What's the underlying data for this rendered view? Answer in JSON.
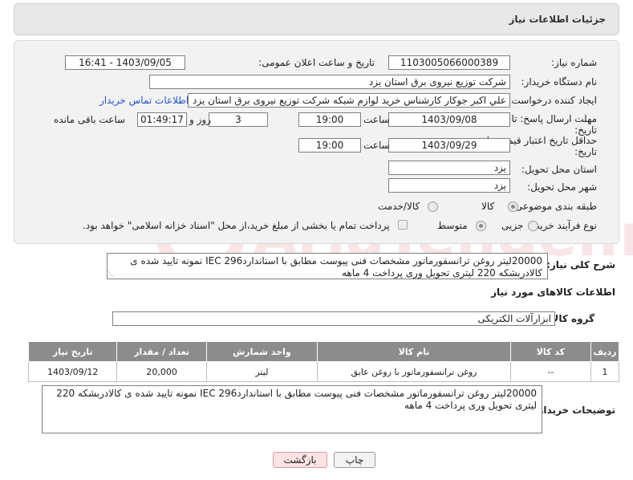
{
  "header": {
    "title": "جزئیات اطلاعات نیاز"
  },
  "form": {
    "need_number_label": "شماره نیاز:",
    "need_number": "1103005066000389",
    "announce_label": "تاریخ و ساعت اعلان عمومی:",
    "announce_value": "1403/09/05 - 16:41",
    "buyer_label": "نام دستگاه خریدار:",
    "buyer_value": "شرکت توزیع نیروی برق استان یزد",
    "requester_label": "ایجاد کننده درخواست:",
    "requester_value": "علي اکبر  جوکار  کارشناس خرید لوازم شبکه  شرکت توزیع نیروی برق استان یزد",
    "contact_link": "اطلاعات تماس خریدار",
    "deadline_label_1": "مهلت ارسال پاسخ: تا",
    "deadline_label_2": "تاریخ:",
    "deadline_date": "1403/09/08",
    "hour_label": "ساعت",
    "deadline_time": "19:00",
    "days_value": "3",
    "days_label": "روز و",
    "remaining_time": "01:49:17",
    "remaining_label": "ساعت باقی مانده",
    "validity_label_1": "حداقل تاریخ اعتبار قیمت: تا",
    "validity_label_2": "تاریخ:",
    "validity_date": "1403/09/29",
    "validity_time": "19:00",
    "province_label": "استان محل تحویل:",
    "province_value": "یزد",
    "city_label": "شهر محل تحویل:",
    "city_value": "یزد",
    "category_label": "طبقه بندی موضوعی:",
    "category_goods": "کالا",
    "category_goods_service": "کالا/خدمت",
    "process_label": "نوع فرآیند خرید :",
    "process_partial": "جزیی",
    "process_medium": "متوسط",
    "payment_note": "پرداخت تمام یا بخشی از مبلغ خرید،از محل \"اسناد خزانه اسلامی\" خواهد بود."
  },
  "description": {
    "label": "شرح کلی نیاز:",
    "text": "20000لیتر روغن ترانسفورماتور  مشخصات فنی پیوست مطابق با استانداردIEC 296  نمونه تایید شده  ی کالادربشکه 220 لیتری تحویل وری پرداخت 4 ماهه"
  },
  "goods_info": {
    "title": "اطلاعات کالاهای مورد نیاز",
    "group_label": "گروه کالا:",
    "group_value": "ابزارآلات الکتریکی"
  },
  "table": {
    "headers": [
      "ردیف",
      "کد کالا",
      "نام کالا",
      "واحد شمارش",
      "تعداد / مقدار",
      "تاریخ نیاز"
    ],
    "rows": [
      [
        "1",
        "--",
        "روغن ترانسفورماتور با روغن عایق",
        "لیتر",
        "20,000",
        "1403/09/12"
      ]
    ]
  },
  "buyer_notes": {
    "label": "توضیحات خریدار:",
    "text": "20000لیتر روغن ترانسفورماتور  مشخصات فنی پیوست مطابق با استانداردIEC 296  نمونه تایید شده  ی کالادربشکه 220 لیتری تحویل وری پرداخت 4 ماهه"
  },
  "buttons": {
    "print": "چاپ",
    "back": "بازگشت"
  },
  "watermark": {
    "text": "AriaTender.neT"
  },
  "colors": {
    "header_bg": "#8c8c8c",
    "link": "#2255cc",
    "back_button": "#fde4e4"
  }
}
